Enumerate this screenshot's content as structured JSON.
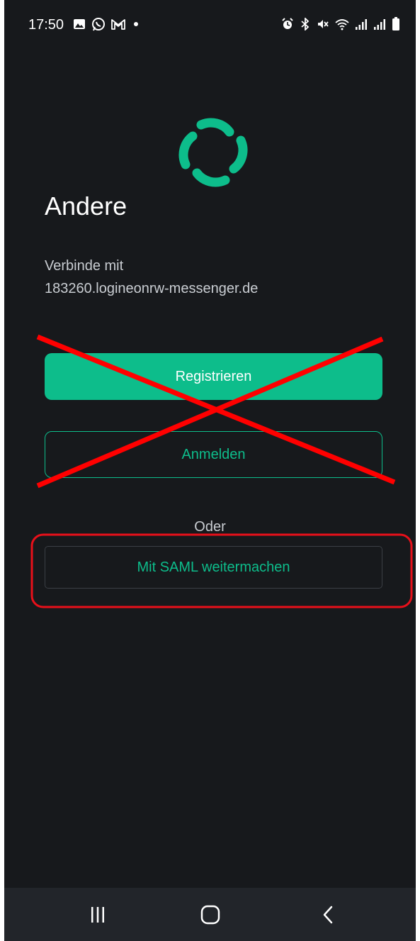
{
  "status_bar": {
    "time": "17:50",
    "notification_icons": [
      "image-icon",
      "whatsapp-icon",
      "gmail-icon",
      "dot-icon"
    ],
    "system_icons": [
      "alarm-icon",
      "bluetooth-icon",
      "mute-icon",
      "wifi-icon",
      "signal-icon",
      "signal-icon",
      "battery-icon"
    ]
  },
  "logo": {
    "icon": "element-logo-icon",
    "color": "#0dbd8b"
  },
  "screen": {
    "title": "Andere",
    "connect_label": "Verbinde mit",
    "server": "183260.logineonrw-messenger.de",
    "register_label": "Registrieren",
    "login_label": "Anmelden",
    "or_label": "Oder",
    "saml_label": "Mit SAML weitermachen"
  },
  "annotations": {
    "cross_color": "#ff0000",
    "highlight_color": "#e8101a"
  },
  "nav_bar": {
    "icons": [
      "recent-apps-icon",
      "home-icon",
      "back-icon"
    ]
  },
  "colors": {
    "background": "#17191c",
    "accent": "#0dbd8b",
    "text_primary": "#ffffff",
    "text_secondary": "#c9cdd2"
  }
}
